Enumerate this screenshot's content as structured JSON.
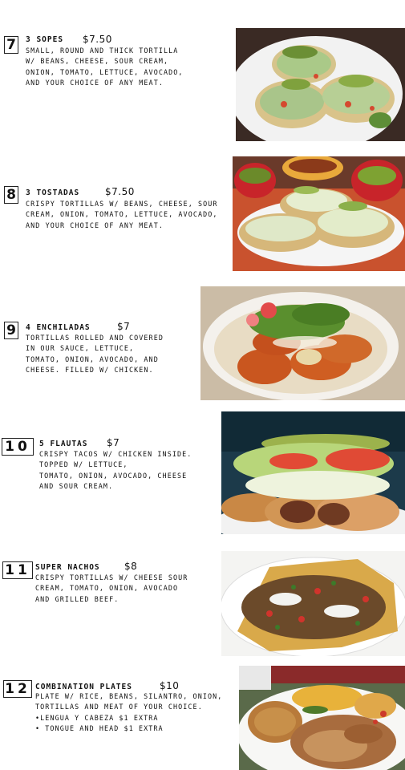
{
  "items": [
    {
      "number": "7",
      "title": "3 sopes",
      "price": "$7.50",
      "lines": [
        "small, round and thick tortilla",
        "w/ beans, cheese, sour cream,",
        "onion, tomato, lettuce, avocado,",
        "and your choice of any meat."
      ],
      "photo": "sopes-photo"
    },
    {
      "number": "8",
      "title": "3 tostadas",
      "price": "$7.50",
      "lines": [
        "crispy tortillas w/ beans, cheese, sour",
        "cream, onion, tomato, lettuce, avocado,",
        "and your choice of any meat."
      ],
      "photo": "tostadas-photo"
    },
    {
      "number": "9",
      "title": "4 enchiladas",
      "price": "$7",
      "lines": [
        "tortillas rolled and covered",
        "in our sauce, lettuce,",
        "tomato, onion, avocado, and",
        "cheese. Filled w/ chicken."
      ],
      "photo": "enchiladas-photo"
    },
    {
      "number": "10",
      "title": "5 flautas",
      "price": "$7",
      "lines": [
        "Crispy tacos w/ chicken inside.",
        "Topped w/ lettuce,",
        "tomato, onion, avocado, cheese",
        "and sour cream."
      ],
      "photo": "flautas-photo"
    },
    {
      "number": "11",
      "title": "super nachos",
      "price": "$8",
      "lines": [
        "crispy tortillas w/ cheese sour",
        "cream, tomato, onion, avocado",
        "and grilled beef."
      ],
      "photo": "nachos-photo"
    },
    {
      "number": "12",
      "title": "combination plates",
      "price": "$10",
      "lines": [
        "plate w/ rice, beans, silantro, onion,",
        "tortillas and meat of your choice.",
        "•lengua y cabeza $1 extra",
        "• tongue and head $1 extra"
      ],
      "photo": "combination-plate-photo"
    }
  ]
}
